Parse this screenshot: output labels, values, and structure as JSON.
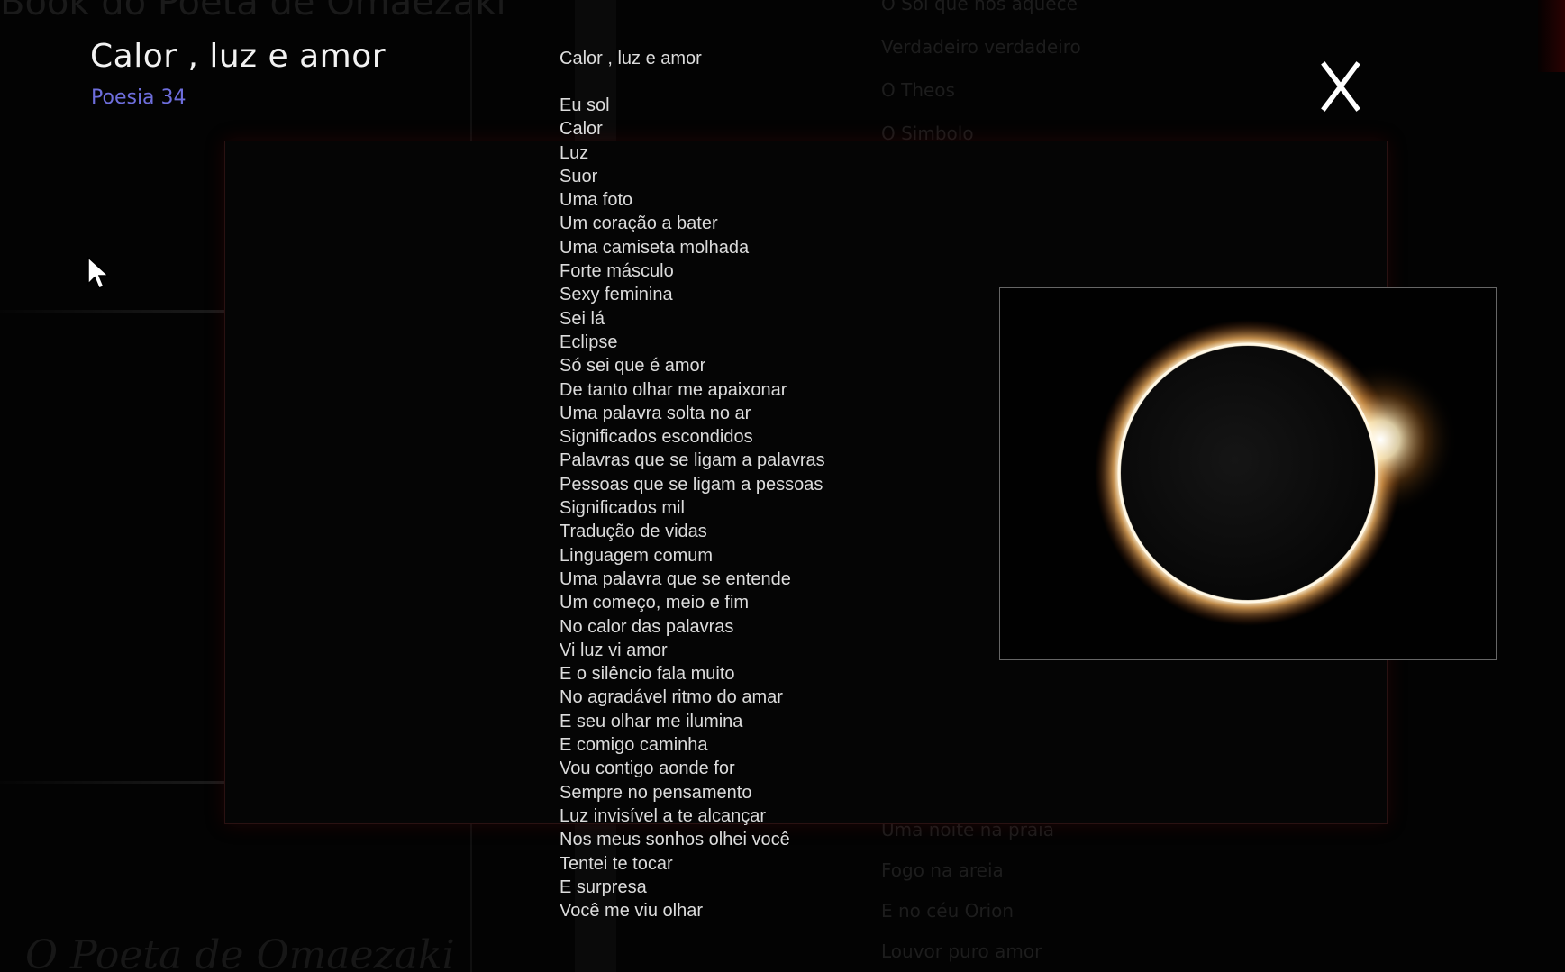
{
  "background": {
    "site_title": "Book do Poeta de Omaezaki",
    "signature": "O Poeta de Omaezaki",
    "menu_top": [
      "O Sol que nos aquece",
      "Verdadeiro  verdadeiro",
      "O Theos",
      "O Simbolo"
    ],
    "menu_bottom": [
      "Uma noite na praia",
      "Fogo na areia",
      "E no céu Orion",
      "Louvor puro amor"
    ]
  },
  "modal": {
    "title": "Calor , luz e amor",
    "subtitle": "Poesia 34",
    "close_label": "X",
    "close_icon": "close-icon",
    "image_icon": "eclipse-photo"
  },
  "poem": {
    "heading": "Calor , luz e amor",
    "lines": [
      "Eu sol",
      "Calor",
      "Luz",
      "Suor",
      "Uma foto",
      "Um coração a bater",
      "Uma camiseta molhada",
      "Forte másculo",
      "Sexy feminina",
      "Sei lá",
      "Eclipse",
      "Só sei que é amor",
      "De tanto olhar me apaixonar",
      "Uma palavra solta no ar",
      "Significados escondidos",
      "Palavras que se ligam a palavras",
      "Pessoas que se ligam a pessoas",
      "Significados mil",
      "Tradução de vidas",
      "Linguagem comum",
      "Uma palavra que se entende",
      "Um começo, meio e fim",
      "No calor das palavras",
      "Vi luz vi amor",
      "E o silêncio fala muito",
      "No agradável ritmo do amar",
      "E seu olhar me ilumina",
      "E comigo caminha",
      "Vou contigo aonde for",
      "Sempre no pensamento",
      "Luz invisível a te alcançar",
      "Nos meus sonhos olhei você",
      "Tentei te tocar",
      "E surpresa",
      "Você me viu olhar"
    ]
  },
  "colors": {
    "background": "#030303",
    "title": "#f2f2f2",
    "subtitle": "#6e6edc",
    "poem_text": "#dcdcdc",
    "panel_glow": "#6e0a0a"
  }
}
